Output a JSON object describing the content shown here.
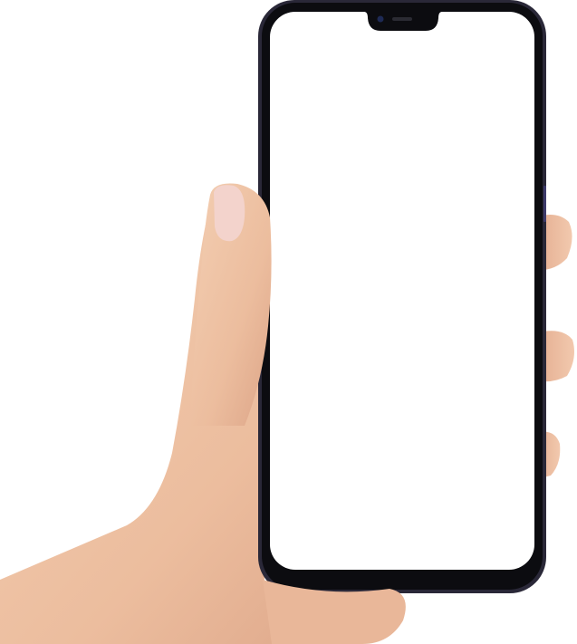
{
  "scene": {
    "subject": "hand-holding-phone",
    "colors": {
      "background": "#ffffff",
      "skin": "#efc4a6",
      "skin_shadow": "#d9a283",
      "nail": "#f3d3cc",
      "phone_frame": "#2a2838",
      "phone_bezel": "#0c0c10",
      "screen": "#ffffff"
    }
  }
}
